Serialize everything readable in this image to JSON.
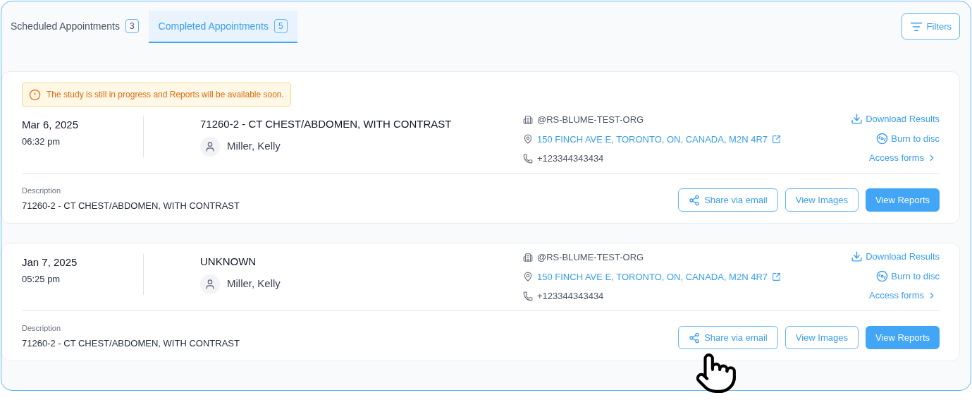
{
  "tabs": [
    {
      "label": "Scheduled Appointments",
      "count": "3",
      "selected": false
    },
    {
      "label": "Completed Appointments",
      "count": "5",
      "selected": true
    }
  ],
  "filters_button": "Filters",
  "appointments": [
    {
      "alert": "The study is still in progress and Reports will be available soon.",
      "date": "Mar 6, 2025",
      "time": "06:32 pm",
      "procedure": "71260-2 - CT CHEST/ABDOMEN, WITH CONTRAST",
      "patient": "Miller, Kelly",
      "organization": "@RS-BLUME-TEST-ORG",
      "address": "150 FINCH AVE E, TORONTO, ON, CANADA, M2N 4R7",
      "phone": "+123344343434",
      "links": [
        {
          "kind": "download",
          "label": "Download Results"
        },
        {
          "kind": "disc",
          "label": "Burn to disc"
        },
        {
          "kind": "forms",
          "label": "Access forms"
        }
      ],
      "description_label": "Description",
      "description": "71260-2 - CT CHEST/ABDOMEN, WITH CONTRAST",
      "buttons": [
        {
          "kind": "share",
          "label": "Share via email"
        },
        {
          "kind": "outline",
          "label": "View Images"
        },
        {
          "kind": "primary",
          "label": "View Reports"
        }
      ]
    },
    {
      "date": "Jan 7, 2025",
      "time": "05:25 pm",
      "procedure": "UNKNOWN",
      "patient": "Miller, Kelly",
      "organization": "@RS-BLUME-TEST-ORG",
      "address": "150 FINCH AVE E, TORONTO, ON, CANADA, M2N 4R7",
      "phone": "+123344343434",
      "links": [
        {
          "kind": "download",
          "label": "Download Results"
        },
        {
          "kind": "disc",
          "label": "Burn to disc"
        },
        {
          "kind": "forms",
          "label": "Access forms"
        }
      ],
      "description_label": "Description",
      "description": "71260-2 - CT CHEST/ABDOMEN, WITH CONTRAST",
      "buttons": [
        {
          "kind": "share",
          "label": "Share via email"
        },
        {
          "kind": "outline",
          "label": "View Images"
        },
        {
          "kind": "primary",
          "label": "View Reports"
        }
      ]
    }
  ]
}
